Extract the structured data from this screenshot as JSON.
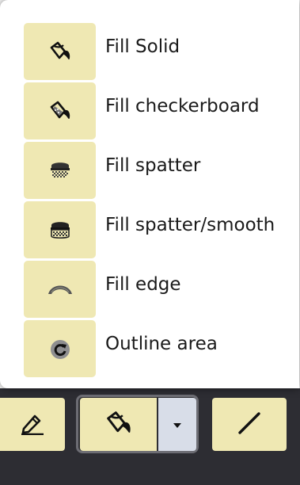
{
  "menu": {
    "items": [
      {
        "label": "Fill Solid",
        "icon": "paint-bucket-icon"
      },
      {
        "label": "Fill checkerboard",
        "icon": "paint-bucket-checker-icon"
      },
      {
        "label": "Fill spatter",
        "icon": "fill-spatter-icon"
      },
      {
        "label": "Fill spatter/smooth",
        "icon": "fill-spatter-smooth-icon"
      },
      {
        "label": "Fill edge",
        "icon": "fill-edge-icon"
      },
      {
        "label": "Outline area",
        "icon": "outline-area-icon"
      }
    ]
  },
  "toolbar": {
    "buttons": [
      {
        "icon": "pencil-icon"
      },
      {
        "icon": "paint-bucket-icon"
      },
      {
        "icon": "chevron-down-icon"
      },
      {
        "icon": "line-icon"
      }
    ]
  },
  "colors": {
    "button_bg": "#efe8b3",
    "toolbar_bg": "#2d2d33",
    "dropdown_bg": "#d8dde8",
    "text": "#1a1a1a"
  }
}
